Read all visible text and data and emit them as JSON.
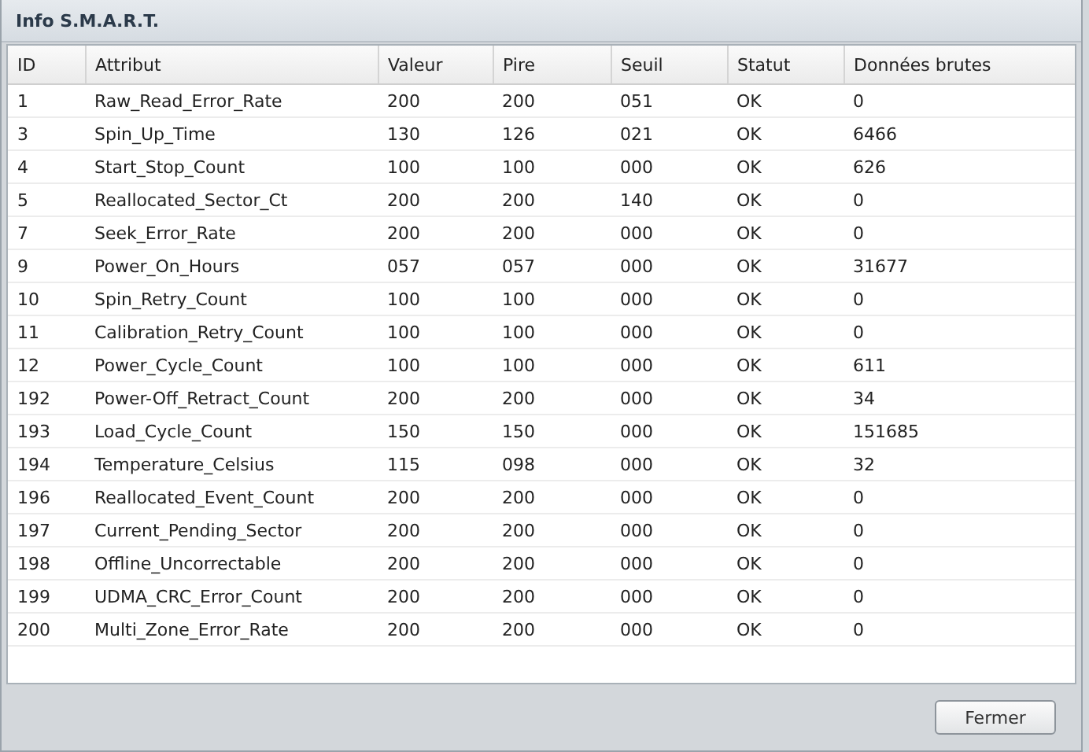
{
  "window": {
    "title": "Info S.M.A.R.T."
  },
  "table": {
    "columns": [
      "ID",
      "Attribut",
      "Valeur",
      "Pire",
      "Seuil",
      "Statut",
      "Données brutes"
    ],
    "rows": [
      [
        "1",
        "Raw_Read_Error_Rate",
        "200",
        "200",
        "051",
        "OK",
        "0"
      ],
      [
        "3",
        "Spin_Up_Time",
        "130",
        "126",
        "021",
        "OK",
        "6466"
      ],
      [
        "4",
        "Start_Stop_Count",
        "100",
        "100",
        "000",
        "OK",
        "626"
      ],
      [
        "5",
        "Reallocated_Sector_Ct",
        "200",
        "200",
        "140",
        "OK",
        "0"
      ],
      [
        "7",
        "Seek_Error_Rate",
        "200",
        "200",
        "000",
        "OK",
        "0"
      ],
      [
        "9",
        "Power_On_Hours",
        "057",
        "057",
        "000",
        "OK",
        "31677"
      ],
      [
        "10",
        "Spin_Retry_Count",
        "100",
        "100",
        "000",
        "OK",
        "0"
      ],
      [
        "11",
        "Calibration_Retry_Count",
        "100",
        "100",
        "000",
        "OK",
        "0"
      ],
      [
        "12",
        "Power_Cycle_Count",
        "100",
        "100",
        "000",
        "OK",
        "611"
      ],
      [
        "192",
        "Power-Off_Retract_Count",
        "200",
        "200",
        "000",
        "OK",
        "34"
      ],
      [
        "193",
        "Load_Cycle_Count",
        "150",
        "150",
        "000",
        "OK",
        "151685"
      ],
      [
        "194",
        "Temperature_Celsius",
        "115",
        "098",
        "000",
        "OK",
        "32"
      ],
      [
        "196",
        "Reallocated_Event_Count",
        "200",
        "200",
        "000",
        "OK",
        "0"
      ],
      [
        "197",
        "Current_Pending_Sector",
        "200",
        "200",
        "000",
        "OK",
        "0"
      ],
      [
        "198",
        "Offline_Uncorrectable",
        "200",
        "200",
        "000",
        "OK",
        "0"
      ],
      [
        "199",
        "UDMA_CRC_Error_Count",
        "200",
        "200",
        "000",
        "OK",
        "0"
      ],
      [
        "200",
        "Multi_Zone_Error_Rate",
        "200",
        "200",
        "000",
        "OK",
        "0"
      ]
    ]
  },
  "buttons": [
    "Fermer"
  ]
}
